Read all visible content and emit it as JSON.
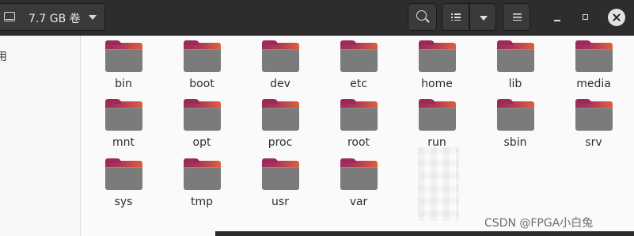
{
  "header": {
    "volume_label": "7.7 GB 卷"
  },
  "sidebar": {
    "partial_label": "用"
  },
  "files": [
    {
      "name": "bin"
    },
    {
      "name": "boot"
    },
    {
      "name": "dev"
    },
    {
      "name": "etc"
    },
    {
      "name": "home"
    },
    {
      "name": "lib"
    },
    {
      "name": "media"
    },
    {
      "name": "mnt"
    },
    {
      "name": "opt"
    },
    {
      "name": "proc"
    },
    {
      "name": "root"
    },
    {
      "name": "run"
    },
    {
      "name": "sbin"
    },
    {
      "name": "srv"
    },
    {
      "name": "sys"
    },
    {
      "name": "tmp"
    },
    {
      "name": "usr"
    },
    {
      "name": "var"
    }
  ],
  "watermark": "CSDN @FPGA小白兔",
  "icons": {
    "drive": "drive-icon",
    "search": "search-icon",
    "view": "list-view-icon",
    "view_menu": "chevron-down-icon",
    "menu": "hamburger-menu-icon",
    "minimize": "minimize-icon",
    "maximize": "maximize-icon",
    "close": "close-icon",
    "folder": "folder-icon"
  },
  "colors": {
    "headerbar": "#2d2d2d",
    "folder_back_start": "#9e2b5b",
    "folder_back_end": "#e15f3b",
    "folder_front": "#7b7b7b",
    "content_bg": "#fafafa"
  }
}
